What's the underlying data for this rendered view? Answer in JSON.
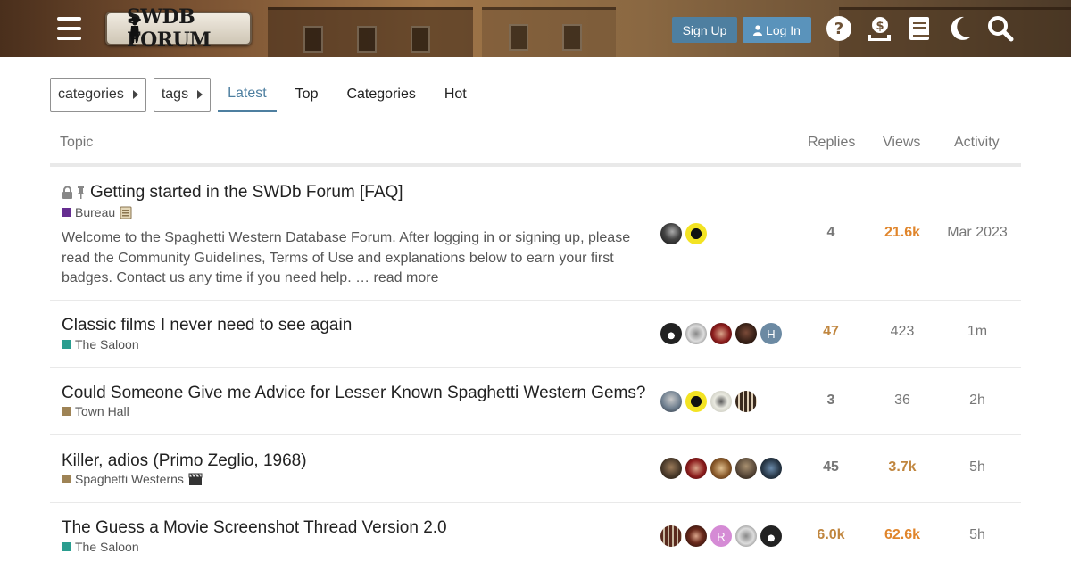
{
  "header": {
    "logo_text": "SWDB FORUM",
    "signup_label": "Sign Up",
    "login_label": "Log In"
  },
  "nav": {
    "dropdowns": [
      "categories",
      "tags"
    ],
    "tabs": [
      "Latest",
      "Top",
      "Categories",
      "Hot"
    ],
    "active_tab": "Latest"
  },
  "table": {
    "headers": {
      "topic": "Topic",
      "replies": "Replies",
      "views": "Views",
      "activity": "Activity"
    },
    "rows": [
      {
        "title": "Getting started in the SWDb Forum [FAQ]",
        "category": "Bureau",
        "category_color": "#652d90",
        "excerpt": "Welcome to the Spaghetti Western Database Forum. After logging in or signing up, please read the Community Guidelines, Terms of Use and explanations below to earn your first badges. Contact us any time if you need help. …",
        "read_more": "read more",
        "replies": "4",
        "views": "21.6k",
        "activity": "Mar 2023"
      },
      {
        "title": "Classic films I never need to see again",
        "category": "The Saloon",
        "category_color": "#2a9d8f",
        "avatar_letter": "H",
        "replies": "47",
        "views": "423",
        "activity": "1m"
      },
      {
        "title": "Could Someone Give me Advice for Lesser Known Spaghetti Western Gems?",
        "category": "Town Hall",
        "category_color": "#9e8355",
        "replies": "3",
        "views": "36",
        "activity": "2h"
      },
      {
        "title": "Killer, adios (Primo Zeglio, 1968)",
        "category": "Spaghetti Westerns",
        "category_color": "#9e8355",
        "replies": "45",
        "views": "3.7k",
        "activity": "5h"
      },
      {
        "title": "The Guess a Movie Screenshot Thread Version 2.0",
        "category": "The Saloon",
        "category_color": "#2a9d8f",
        "avatar_letter": "R",
        "replies": "6.0k",
        "views": "62.6k",
        "activity": "5h"
      }
    ]
  },
  "colors": {
    "accent": "#4e7fa0",
    "hot_views": "#e0852b"
  }
}
